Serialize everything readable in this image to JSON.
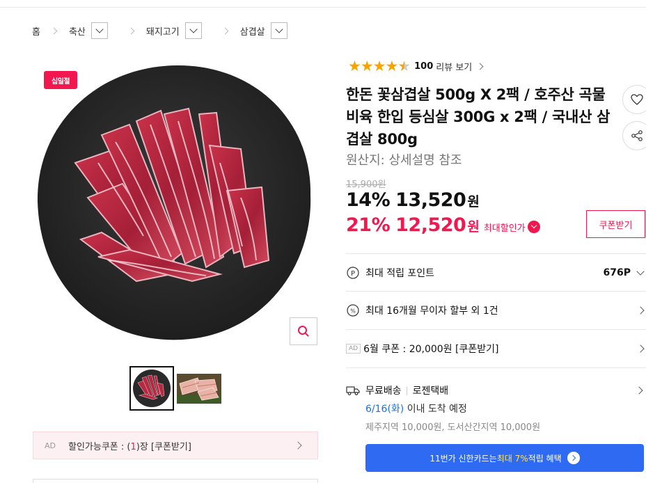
{
  "breadcrumb": {
    "home": "홈",
    "items": [
      {
        "label": "축산"
      },
      {
        "label": "돼지고기"
      },
      {
        "label": "삼겹살"
      }
    ]
  },
  "product": {
    "badge": "십일절",
    "rating": 4.5,
    "review_count": "100",
    "review_link": "리뷰 보기",
    "title": "한돈 꽃삼겹살 500g X 2팩 / 호주산 곡물비육 한입 등심살 300G x 2팩 / 국내산 삼겹살 800g",
    "origin": "원산지:  상세설명 참조",
    "original_price": "15,900원",
    "sale": {
      "percent": "14%",
      "amount": "13,520",
      "unit": "원"
    },
    "max_sale": {
      "percent": "21%",
      "amount": "12,520",
      "unit": "원",
      "label": "최대할인가"
    },
    "coupon_button": "쿠폰받기"
  },
  "info_rows": {
    "points": {
      "label": "최대 적립 포인트",
      "value": "676P"
    },
    "installment": {
      "label": "최대 16개월 무이자 할부 외 1건"
    },
    "coupon": {
      "ad": "AD",
      "label": "6월 쿠폰 : 20,000원 [쿠폰받기]"
    },
    "shipping": {
      "free": "무료배송",
      "carrier": "로젠택배",
      "date": "6/16(화)",
      "date_suffix": " 이내 도착 예정",
      "fee": "제주지역 10,000원, 도서산간지역 10,000원"
    }
  },
  "card_banner": {
    "prefix": "11번가 신한카드는 ",
    "highlight": "최대 7%",
    "suffix": " 적립 혜택"
  },
  "coupon_bar": {
    "ad": "AD",
    "prefix": "할인가능쿠폰 : (",
    "count": "1",
    "suffix": ")장 [쿠폰받기]"
  },
  "colors": {
    "accent": "#f2184f",
    "blue": "#2f6bf2",
    "star": "#f7a300"
  }
}
